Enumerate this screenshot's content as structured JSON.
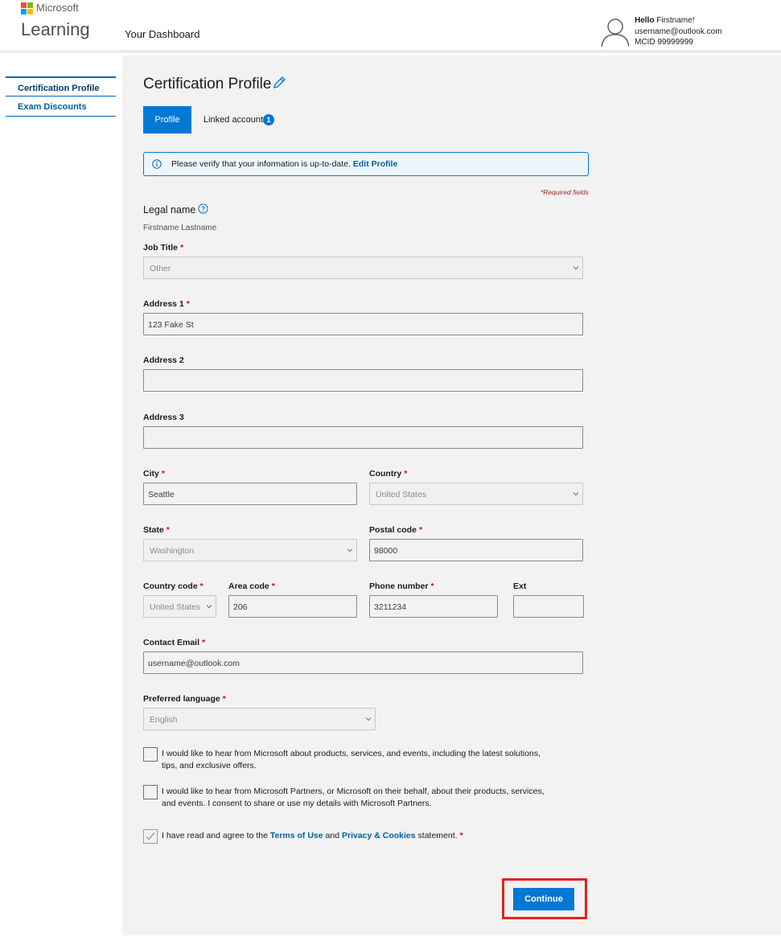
{
  "header": {
    "brand": "Microsoft",
    "product": "Learning",
    "nav_dashboard": "Your Dashboard",
    "user": {
      "greeting": "Hello",
      "name": "Firstname!",
      "email": "username@outlook.com",
      "mcid": "MCID 99999999"
    }
  },
  "sidebar": {
    "items": [
      {
        "label": "Certification Profile",
        "active": true
      },
      {
        "label": "Exam Discounts",
        "active": false
      }
    ]
  },
  "page": {
    "title": "Certification Profile",
    "tabs": [
      {
        "label": "Profile",
        "active": true
      },
      {
        "label": "Linked account",
        "badge": "1",
        "active": false
      }
    ],
    "info_banner": {
      "text": "Please verify that your information is up-to-date.",
      "link": "Edit Profile"
    },
    "required_note": "*Required fields",
    "legal_name": {
      "label": "Legal name",
      "value": "Firstname Lastname"
    }
  },
  "form": {
    "required_marker": "*",
    "job_title": {
      "label": "Job Title",
      "value": "Other"
    },
    "address1": {
      "label": "Address 1",
      "value": "123 Fake St"
    },
    "address2": {
      "label": "Address 2",
      "value": ""
    },
    "address3": {
      "label": "Address 3",
      "value": ""
    },
    "city": {
      "label": "City",
      "value": "Seattle"
    },
    "country": {
      "label": "Country",
      "value": "United States"
    },
    "state": {
      "label": "State",
      "value": "Washington"
    },
    "postal_code": {
      "label": "Postal code",
      "value": "98000"
    },
    "country_code": {
      "label": "Country code",
      "value": "United States"
    },
    "area_code": {
      "label": "Area code",
      "value": "206"
    },
    "phone_number": {
      "label": "Phone number",
      "value": "3211234"
    },
    "ext": {
      "label": "Ext",
      "value": ""
    },
    "contact_email": {
      "label": "Contact Email",
      "value": "username@outlook.com"
    },
    "preferred_language": {
      "label": "Preferred language",
      "value": "English"
    },
    "consent_microsoft": {
      "line1": "I would like to hear from Microsoft about products, services, and events, including the latest solutions,",
      "line2": "tips, and exclusive offers.",
      "checked": false
    },
    "consent_partners": {
      "line1": "I would like to hear from Microsoft Partners, or Microsoft on their behalf, about their products, services,",
      "line2": "and events. I consent to share or use my details with Microsoft Partners.",
      "checked": false
    },
    "terms": {
      "prefix": "I have read and agree to the",
      "terms_link": "Terms of Use",
      "middle": "and",
      "privacy_link": "Privacy & Cookies",
      "suffix": "statement.",
      "checked": true
    },
    "continue_label": "Continue"
  },
  "colors": {
    "accent": "#0078d4",
    "link": "#0060a0",
    "required": "#c50f1f",
    "highlight_frame": "#e3241a",
    "panel_bg": "#f2f2f2"
  },
  "icons": {
    "logo": "microsoft-logo",
    "avatar": "user-avatar-icon",
    "edit": "pencil-icon",
    "info": "info-icon",
    "help": "help-circle-icon",
    "dropdown": "chevron-down-icon",
    "check": "checkmark-icon"
  }
}
